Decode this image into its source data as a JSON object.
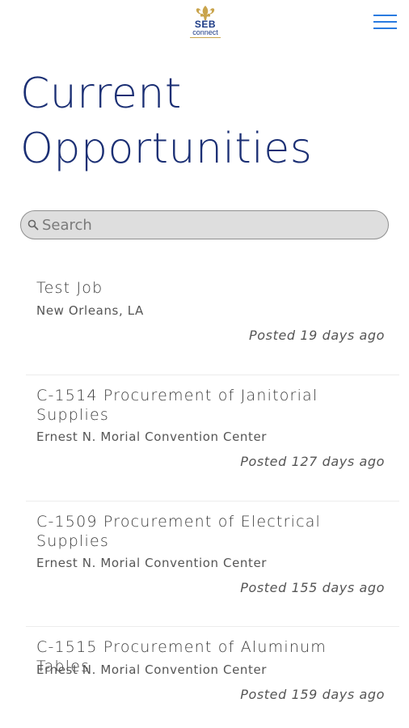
{
  "header": {
    "logo": {
      "word": "SEB",
      "sub": "connect"
    },
    "menu_icon": "hamburger-menu-icon"
  },
  "page_title": {
    "line1": "Current",
    "line2": "Opportunities"
  },
  "search": {
    "placeholder": "Search",
    "value": "",
    "icon": "search-icon"
  },
  "jobs": [
    {
      "title": "Test Job",
      "location": "New Orleans, LA",
      "posted": "Posted 19 days ago"
    },
    {
      "title": "C-1514 Procurement of Janitorial Supplies",
      "location": "Ernest N. Morial Convention Center",
      "posted": "Posted 127 days ago"
    },
    {
      "title": "C-1509 Procurement of Electrical Supplies",
      "location": "Ernest N. Morial Convention Center",
      "posted": "Posted 155 days ago"
    },
    {
      "title": "C-1515 Procurement of Aluminum Tables",
      "location": "Ernest N. Morial Convention Center",
      "posted": "Posted 159 days ago"
    }
  ],
  "colors": {
    "title": "#1b2f74",
    "menu": "#2a7be0",
    "logo_blue": "#1d3b86",
    "logo_gold": "#c9a44c",
    "search_bg": "#dedede"
  }
}
